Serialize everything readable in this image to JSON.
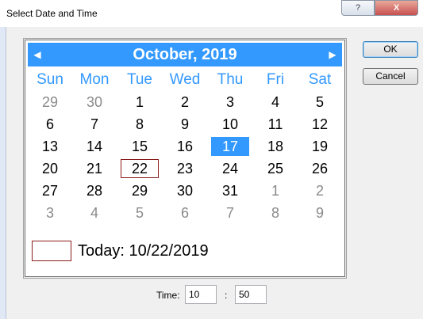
{
  "window": {
    "title": "Select Date and Time",
    "help_glyph": "?",
    "close_glyph": "X"
  },
  "calendar": {
    "month_title": "October, 2019",
    "prev_glyph": "◀",
    "next_glyph": "▶",
    "days_of_week": [
      "Sun",
      "Mon",
      "Tue",
      "Wed",
      "Thu",
      "Fri",
      "Sat"
    ],
    "weeks": [
      [
        {
          "d": "29",
          "m": "prev"
        },
        {
          "d": "30",
          "m": "prev"
        },
        {
          "d": "1"
        },
        {
          "d": "2"
        },
        {
          "d": "3"
        },
        {
          "d": "4"
        },
        {
          "d": "5"
        }
      ],
      [
        {
          "d": "6"
        },
        {
          "d": "7"
        },
        {
          "d": "8"
        },
        {
          "d": "9"
        },
        {
          "d": "10"
        },
        {
          "d": "11"
        },
        {
          "d": "12"
        }
      ],
      [
        {
          "d": "13"
        },
        {
          "d": "14"
        },
        {
          "d": "15"
        },
        {
          "d": "16"
        },
        {
          "d": "17",
          "sel": true
        },
        {
          "d": "18"
        },
        {
          "d": "19"
        }
      ],
      [
        {
          "d": "20"
        },
        {
          "d": "21"
        },
        {
          "d": "22",
          "today": true
        },
        {
          "d": "23"
        },
        {
          "d": "24"
        },
        {
          "d": "25"
        },
        {
          "d": "26"
        }
      ],
      [
        {
          "d": "27"
        },
        {
          "d": "28"
        },
        {
          "d": "29"
        },
        {
          "d": "30"
        },
        {
          "d": "31"
        },
        {
          "d": "1",
          "m": "next"
        },
        {
          "d": "2",
          "m": "next"
        }
      ],
      [
        {
          "d": "3",
          "m": "next"
        },
        {
          "d": "4",
          "m": "next"
        },
        {
          "d": "5",
          "m": "next"
        },
        {
          "d": "6",
          "m": "next"
        },
        {
          "d": "7",
          "m": "next"
        },
        {
          "d": "8",
          "m": "next"
        },
        {
          "d": "9",
          "m": "next"
        }
      ]
    ],
    "today_label": "Today: 10/22/2019",
    "accent_color": "#3399ff"
  },
  "buttons": {
    "ok": "OK",
    "cancel": "Cancel"
  },
  "time": {
    "label": "Time:",
    "hour": "10",
    "separator": ":",
    "minute": "50"
  }
}
